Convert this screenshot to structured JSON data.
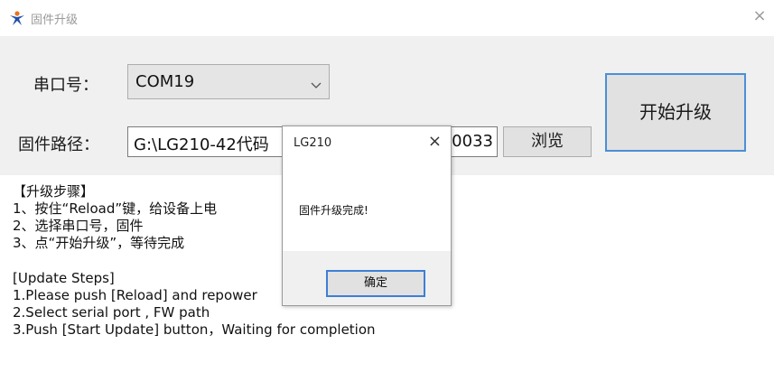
{
  "window": {
    "title": "固件升级",
    "close_glyph": "×"
  },
  "form": {
    "port_label": "串口号：",
    "port_value": "COM19",
    "path_label": "固件路径：",
    "path_value": "G:\\LG210-42代码",
    "path_tail": "20033",
    "browse_label": "浏览",
    "start_label": "开始升级"
  },
  "steps": {
    "cn": [
      "【升级步骤】",
      "1、按住“Reload”键，给设备上电",
      "2、选择串口号，固件",
      "3、点“开始升级”，等待完成"
    ],
    "en": [
      "[Update Steps]",
      "1.Please push [Reload] and repower",
      "2.Select serial port , FW path",
      "3.Push [Start Update] button，Waiting for completion"
    ]
  },
  "dialog": {
    "title": "LG210",
    "close_glyph": "×",
    "message": "固件升级完成!",
    "ok_label": "确定"
  },
  "colors": {
    "panel_bg": "#f0f0f0",
    "focus_border": "#3c7fd6",
    "icon_orange": "#e8731c",
    "icon_blue": "#1f4fa8"
  }
}
